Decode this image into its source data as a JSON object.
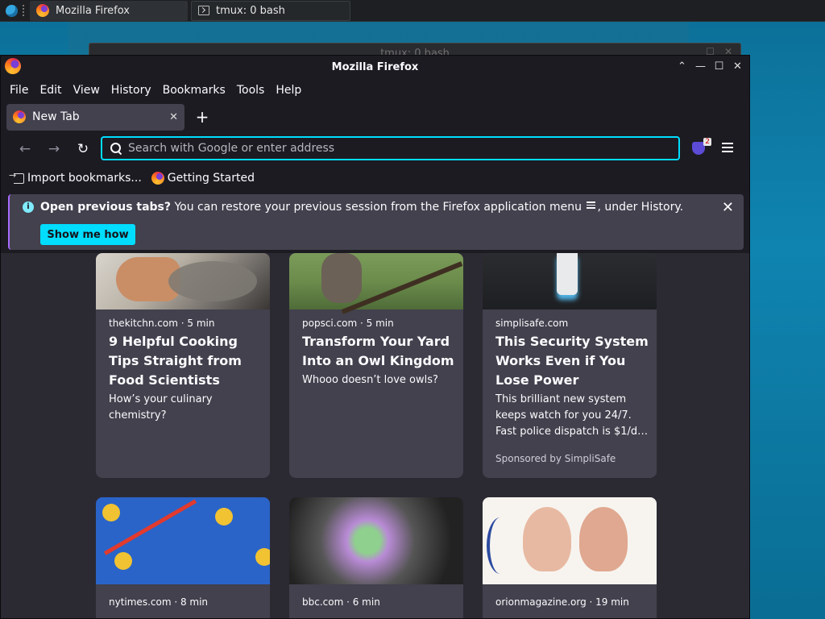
{
  "taskbar": {
    "tasks": [
      {
        "label": "Mozilla Firefox",
        "icon": "firefox-icon",
        "active": true
      },
      {
        "label": "tmux: 0 bash",
        "icon": "terminal-icon",
        "active": false
      }
    ]
  },
  "background_window": {
    "title": "tmux: 0 bash"
  },
  "window": {
    "title": "Mozilla Firefox",
    "controls": {
      "shade": "⌃",
      "minimize": "—",
      "maximize": "☐",
      "close": "✕"
    }
  },
  "menubar": {
    "items": [
      "File",
      "Edit",
      "View",
      "History",
      "Bookmarks",
      "Tools",
      "Help"
    ]
  },
  "tabs": [
    {
      "label": "New Tab",
      "close": "✕"
    }
  ],
  "newtab_symbol": "+",
  "navbar": {
    "back": "←",
    "forward": "→",
    "reload": "↻",
    "url_placeholder": "Search with Google or enter address",
    "url_value": "",
    "extension_badge": "2"
  },
  "bookmarks": [
    {
      "label": "Import bookmarks...",
      "icon": "import-icon"
    },
    {
      "label": "Getting Started",
      "icon": "firefox-icon"
    }
  ],
  "notification": {
    "info_glyph": "i",
    "title": "Open previous tabs?",
    "message_before": " You can restore your previous session from the Firefox application menu ",
    "message_after": ", under History.",
    "button": "Show me how",
    "close": "✕"
  },
  "stories": [
    {
      "source": "thekitchn.com · 5 min",
      "title": "9 Helpful Cooking Tips Straight from Food Scientists",
      "excerpt": "How’s your culinary chemistry?",
      "sponsor": ""
    },
    {
      "source": "popsci.com · 5 min",
      "title": "Transform Your Yard Into an Owl Kingdom",
      "excerpt": "Whooo doesn’t love owls?",
      "sponsor": ""
    },
    {
      "source": "simplisafe.com",
      "title": "This Security System Works Even if You Lose Power",
      "excerpt": "This brilliant new system keeps watch for you 24/7. Fast police dispatch is $1/d…",
      "sponsor": "Sponsored by SimpliSafe"
    },
    {
      "source": "nytimes.com · 8 min"
    },
    {
      "source": "bbc.com · 6 min"
    },
    {
      "source": "orionmagazine.org · 19 min"
    }
  ],
  "colors": {
    "accent": "#00ddff",
    "surface": "#42414d",
    "background": "#2b2a33",
    "chrome": "#1c1b22"
  }
}
